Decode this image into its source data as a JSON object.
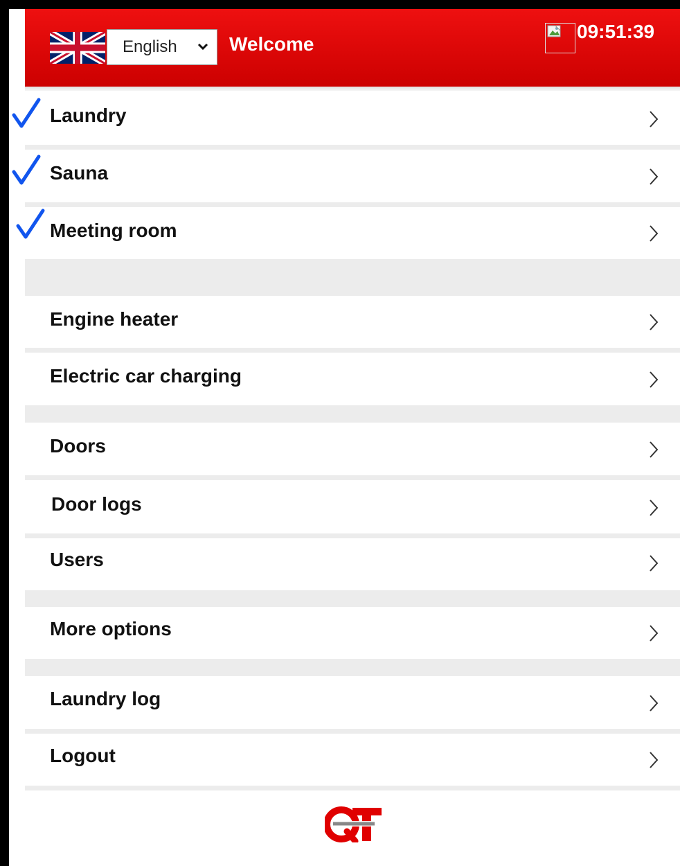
{
  "header": {
    "language": "English",
    "welcome": "Welcome",
    "time": "09:51:39",
    "background_color": "#dd0000",
    "flag_icon": "uk-flag-icon",
    "image_icon": "broken-image-icon"
  },
  "menu": {
    "group1": [
      {
        "label": "Laundry",
        "checked": true
      },
      {
        "label": "Sauna",
        "checked": true
      },
      {
        "label": "Meeting room",
        "checked": true
      }
    ],
    "group2": [
      {
        "label": "Engine heater"
      },
      {
        "label": "Electric car charging"
      }
    ],
    "group3": [
      {
        "label": "Doors"
      },
      {
        "label": "Door logs"
      },
      {
        "label": "Users"
      }
    ],
    "group4": [
      {
        "label": "More options"
      }
    ],
    "group5": [
      {
        "label": "Laundry log"
      },
      {
        "label": "Logout"
      }
    ]
  },
  "footer": {
    "logo_icon": "qt-systems-logo",
    "logo_color": "#e00000"
  },
  "colors": {
    "checkmark": "#1155ee",
    "separator": "#ececec",
    "text": "#111111"
  }
}
